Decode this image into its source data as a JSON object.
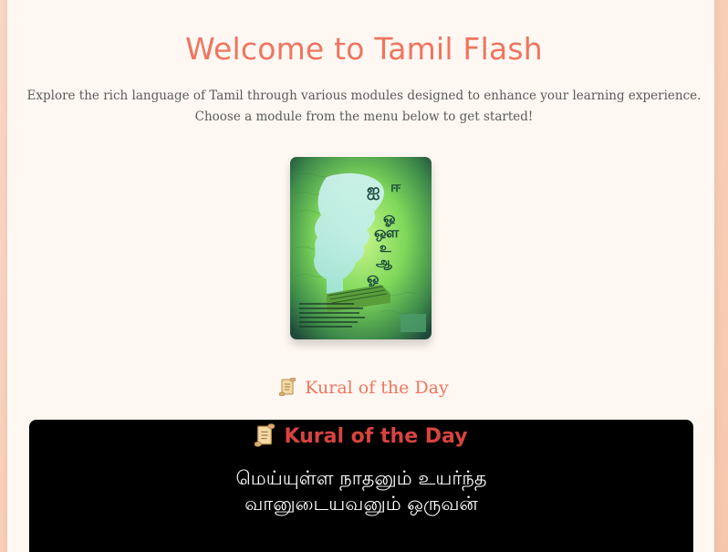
{
  "page": {
    "title": "Welcome to Tamil Flash",
    "intro_line1": "Explore the rich language of Tamil through various modules designed to enhance your learning experience.",
    "intro_line2": "Choose a module from the menu below to get started!"
  },
  "kural_section": {
    "heading": "Kural of the Day",
    "icon": "scroll-icon"
  },
  "kural_box": {
    "heading": "Kural of the Day",
    "icon": "scroll-icon",
    "line1": "மெய்யுள்ள நாதனும் உயர்ந்த",
    "line2": "வானுடையவனும் ஒருவன்"
  },
  "colors": {
    "accent": "#ef7560",
    "box_heading": "#d9433f",
    "card_bg": "#fff8f2",
    "page_bg": "#f8cfb8"
  }
}
